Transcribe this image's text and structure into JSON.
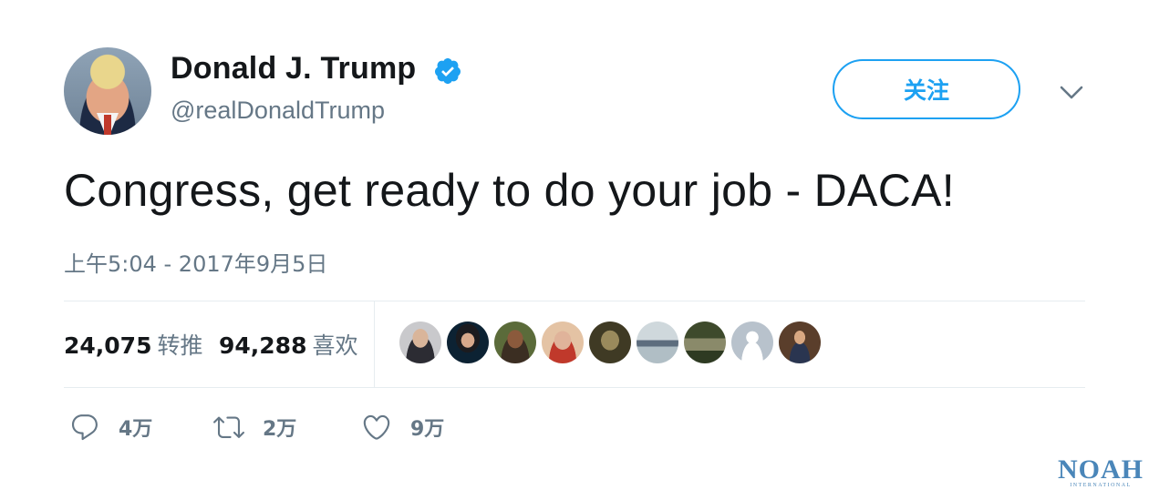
{
  "author": {
    "display_name": "Donald J. Trump",
    "handle": "@realDonaldTrump",
    "verified": true
  },
  "header": {
    "follow_label": "关注"
  },
  "tweet": {
    "text": "Congress, get ready to do your job - DACA!",
    "timestamp": "上午5:04 - 2017年9月5日"
  },
  "stats": {
    "retweets_count": "24,075",
    "retweets_label": "转推",
    "likes_count": "94,288",
    "likes_label": "喜欢"
  },
  "actions": {
    "reply_count": "4万",
    "retweet_count": "2万",
    "like_count": "9万"
  },
  "watermark": {
    "name": "NOAH",
    "sub": "INTERNATIONAL"
  },
  "colors": {
    "accent": "#1da1f2",
    "text_primary": "#14171a",
    "text_secondary": "#657786",
    "divider": "#e6ecf0"
  }
}
